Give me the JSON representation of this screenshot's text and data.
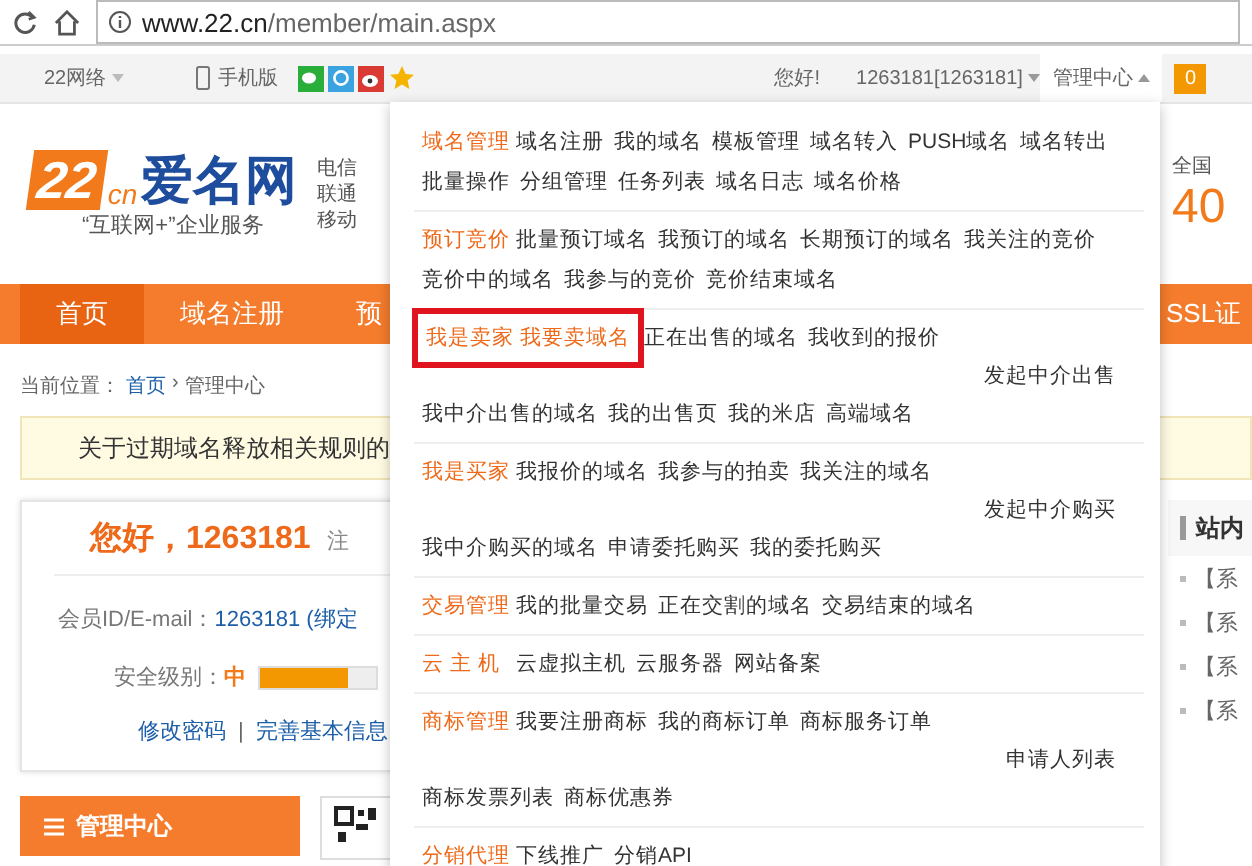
{
  "browser": {
    "url_host": "www.22.cn",
    "url_path": "/member/main.aspx"
  },
  "topbar": {
    "brand": "22网络",
    "mobile": "手机版",
    "greeting": "您好!",
    "account": "1263181[1263181]",
    "menu": "管理中心",
    "menu_open": true,
    "badge": "0"
  },
  "header": {
    "logo": {
      "mark": "22",
      "suffix": "cn",
      "name": "爱名网",
      "slogan": "“互联网+”企业服务"
    },
    "carriers": [
      "电信",
      "联通",
      "移动"
    ],
    "stat_label": "全国",
    "stat_value": "40"
  },
  "nav": [
    {
      "label": "首页",
      "selected": true
    },
    {
      "label": "域名注册",
      "selected": false
    },
    {
      "label": "预",
      "selected": false
    }
  ],
  "nav_right": "SSL证",
  "breadcrumb": {
    "label": "当前位置：",
    "separator": "›",
    "items": [
      {
        "label": "首页",
        "link": true
      },
      {
        "label": "管理中心",
        "link": false
      }
    ]
  },
  "notice": "关于过期域名释放相关规则的",
  "user": {
    "greeting": "您好，1263181",
    "note": "注",
    "id_label": "会员ID/E-mail：",
    "id_value": "1263181 (绑定",
    "security_label": "安全级别：",
    "security_value": "中",
    "level": 0.75,
    "links": [
      "修改密码",
      "完善基本信息"
    ],
    "link_separator": "|"
  },
  "sidebar": {
    "title": "管理中心"
  },
  "messages": {
    "title": "站内",
    "items": [
      "【系",
      "【系",
      "【系",
      "【系"
    ]
  },
  "dropdown": [
    {
      "heading": "域名管理",
      "highlighted": false,
      "links": [
        "域名注册",
        "我的域名",
        "模板管理",
        "域名转入",
        "PUSH域名",
        "域名转出",
        "批量操作",
        "分组管理",
        "任务列表",
        "域名日志",
        "域名价格"
      ]
    },
    {
      "heading": "预订竞价",
      "highlighted": false,
      "links": [
        "批量预订域名",
        "我预订的域名",
        "长期预订的域名",
        "我关注的竞价",
        "竞价中的域名",
        "我参与的竞价",
        "竞价结束域名"
      ]
    },
    {
      "heading": "我是卖家",
      "highlighted": true,
      "featured_link": "我要卖域名",
      "links": [
        "正在出售的域名",
        "我收到的报价"
      ],
      "side_link": "发起中介出售",
      "more_links": [
        "我中介出售的域名",
        "我的出售页",
        "我的米店",
        "高端域名"
      ]
    },
    {
      "heading": "我是买家",
      "highlighted": false,
      "links": [
        "我报价的域名",
        "我参与的拍卖",
        "我关注的域名"
      ],
      "side_link": "发起中介购买",
      "more_links": [
        "我中介购买的域名",
        "申请委托购买",
        "我的委托购买"
      ]
    },
    {
      "heading": "交易管理",
      "highlighted": false,
      "links": [
        "我的批量交易",
        "正在交割的域名",
        "交易结束的域名"
      ]
    },
    {
      "heading": "云 主 机",
      "highlighted": false,
      "links": [
        "云虚拟主机",
        "云服务器",
        "网站备案"
      ]
    },
    {
      "heading": "商标管理",
      "highlighted": false,
      "links": [
        "我要注册商标",
        "我的商标订单",
        "商标服务订单"
      ],
      "side_link": "申请人列表",
      "more_links": [
        "商标发票列表",
        "商标优惠券"
      ]
    },
    {
      "heading": "分销代理",
      "highlighted": false,
      "links": [
        "下线推广",
        "分销API"
      ]
    }
  ]
}
